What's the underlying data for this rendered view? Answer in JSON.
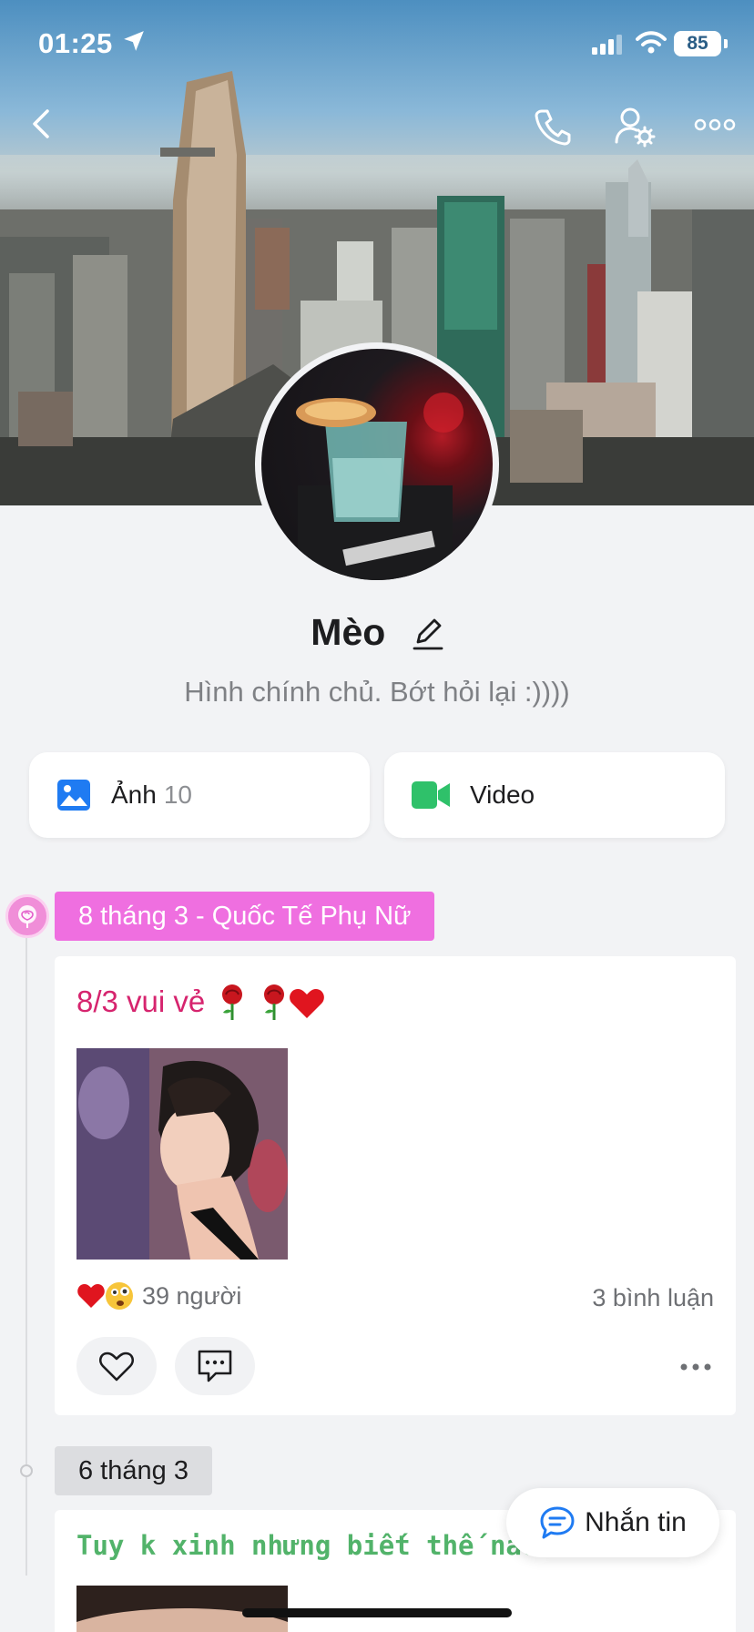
{
  "status_bar": {
    "time": "01:25",
    "battery": "85"
  },
  "profile": {
    "name": "Mèo",
    "bio": "Hình chính chủ. Bớt hỏi lại :))))"
  },
  "media": {
    "photos_label": "Ảnh",
    "photos_count": "10",
    "video_label": "Video"
  },
  "timeline": [
    {
      "tag": "8 tháng 3 - Quốc Tế Phụ Nữ",
      "post_text": "8/3 vui vẻ",
      "reactions": "39 người",
      "comments": "3 bình luận"
    },
    {
      "tag": "6 tháng 3",
      "post_text": "Tuy k xinh nhưng biết thế nào"
    }
  ],
  "message_button": {
    "label": "Nhắn tin"
  },
  "colors": {
    "accent_blue": "#1f7bf2",
    "video_green": "#2fc16a",
    "tag_pink": "#ef6fe0",
    "post_pink": "#d6246e",
    "post_green": "#52b36a"
  },
  "icons": [
    "back-icon",
    "phone-icon",
    "user-settings-icon",
    "more-icon",
    "edit-icon",
    "photo-icon",
    "video-icon",
    "rose-icon",
    "heart-icon",
    "comment-icon",
    "chat-icon"
  ]
}
